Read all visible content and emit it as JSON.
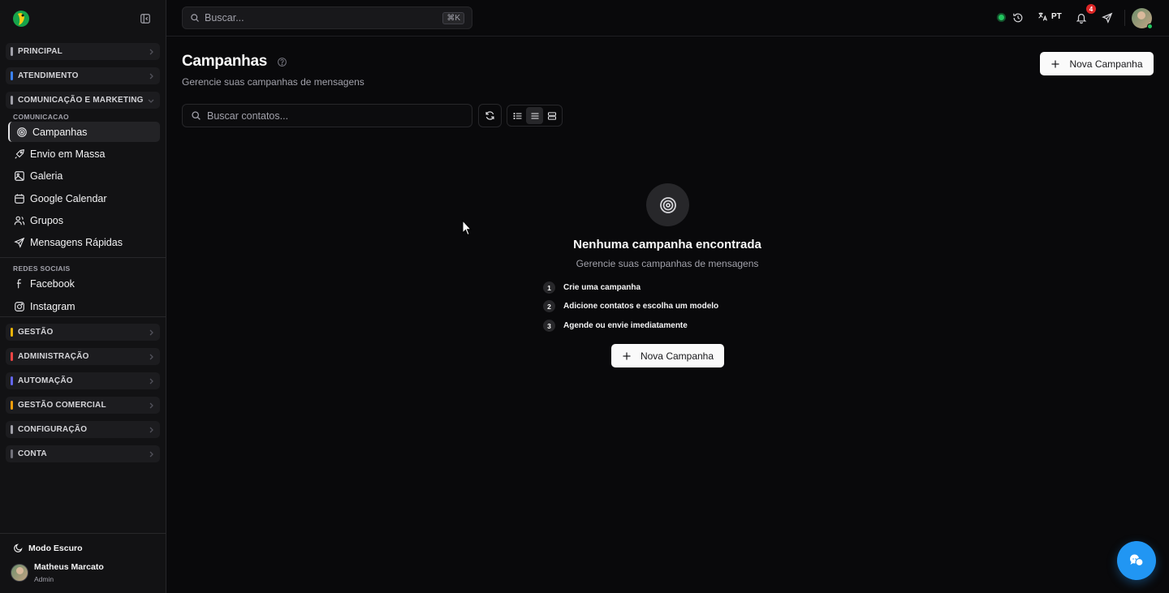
{
  "colors": {
    "accent": "#2196f3",
    "success": "#22c55e",
    "danger": "#dc2626",
    "background": "#09090b",
    "sidebar": "#121214"
  },
  "topbar": {
    "search_placeholder": "Buscar...",
    "search_shortcut": "⌘K",
    "language": "PT",
    "notifications_count": "4"
  },
  "sidebar": {
    "groups": [
      {
        "label": "PRINCIPAL",
        "color": "#a1a1aa"
      },
      {
        "label": "ATENDIMENTO",
        "color": "#3b82f6"
      },
      {
        "label": "COMUNICAÇÃO E MARKETING",
        "color": "#a1a1aa"
      },
      {
        "label": "GESTÃO",
        "color": "#eab308"
      },
      {
        "label": "ADMINISTRAÇÃO",
        "color": "#ef4444"
      },
      {
        "label": "AUTOMAÇÃO",
        "color": "#6366f1"
      },
      {
        "label": "GESTÃO COMERCIAL",
        "color": "#f59e0b"
      },
      {
        "label": "CONFIGURAÇÃO",
        "color": "#a1a1aa"
      },
      {
        "label": "CONTA",
        "color": "#71717a"
      }
    ],
    "section_comunicacao": "COMUNICACAO",
    "section_redes": "REDES SOCIAIS",
    "items": [
      {
        "label": "Campanhas",
        "icon": "target-icon"
      },
      {
        "label": "Envio em Massa",
        "icon": "rocket-icon"
      },
      {
        "label": "Galeria",
        "icon": "image-icon"
      },
      {
        "label": "Google Calendar",
        "icon": "calendar-icon"
      },
      {
        "label": "Grupos",
        "icon": "users-icon"
      },
      {
        "label": "Mensagens Rápidas",
        "icon": "send-icon"
      },
      {
        "label": "Facebook",
        "icon": "facebook-icon"
      },
      {
        "label": "Instagram",
        "icon": "instagram-icon"
      }
    ],
    "dark_mode_label": "Modo Escuro",
    "user_name": "Matheus Marcato",
    "user_role": "Admin"
  },
  "main": {
    "title": "Campanhas",
    "subtitle": "Gerencie suas campanhas de mensagens",
    "new_button": "Nova Campanha",
    "search_placeholder": "Buscar contatos...",
    "empty": {
      "title": "Nenhuma campanha encontrada",
      "subtitle": "Gerencie suas campanhas de mensagens",
      "steps": [
        {
          "num": "1",
          "text": "Crie uma campanha"
        },
        {
          "num": "2",
          "text": "Adicione contatos e escolha um modelo"
        },
        {
          "num": "3",
          "text": "Agende ou envie imediatamente"
        }
      ],
      "button": "Nova Campanha"
    }
  }
}
